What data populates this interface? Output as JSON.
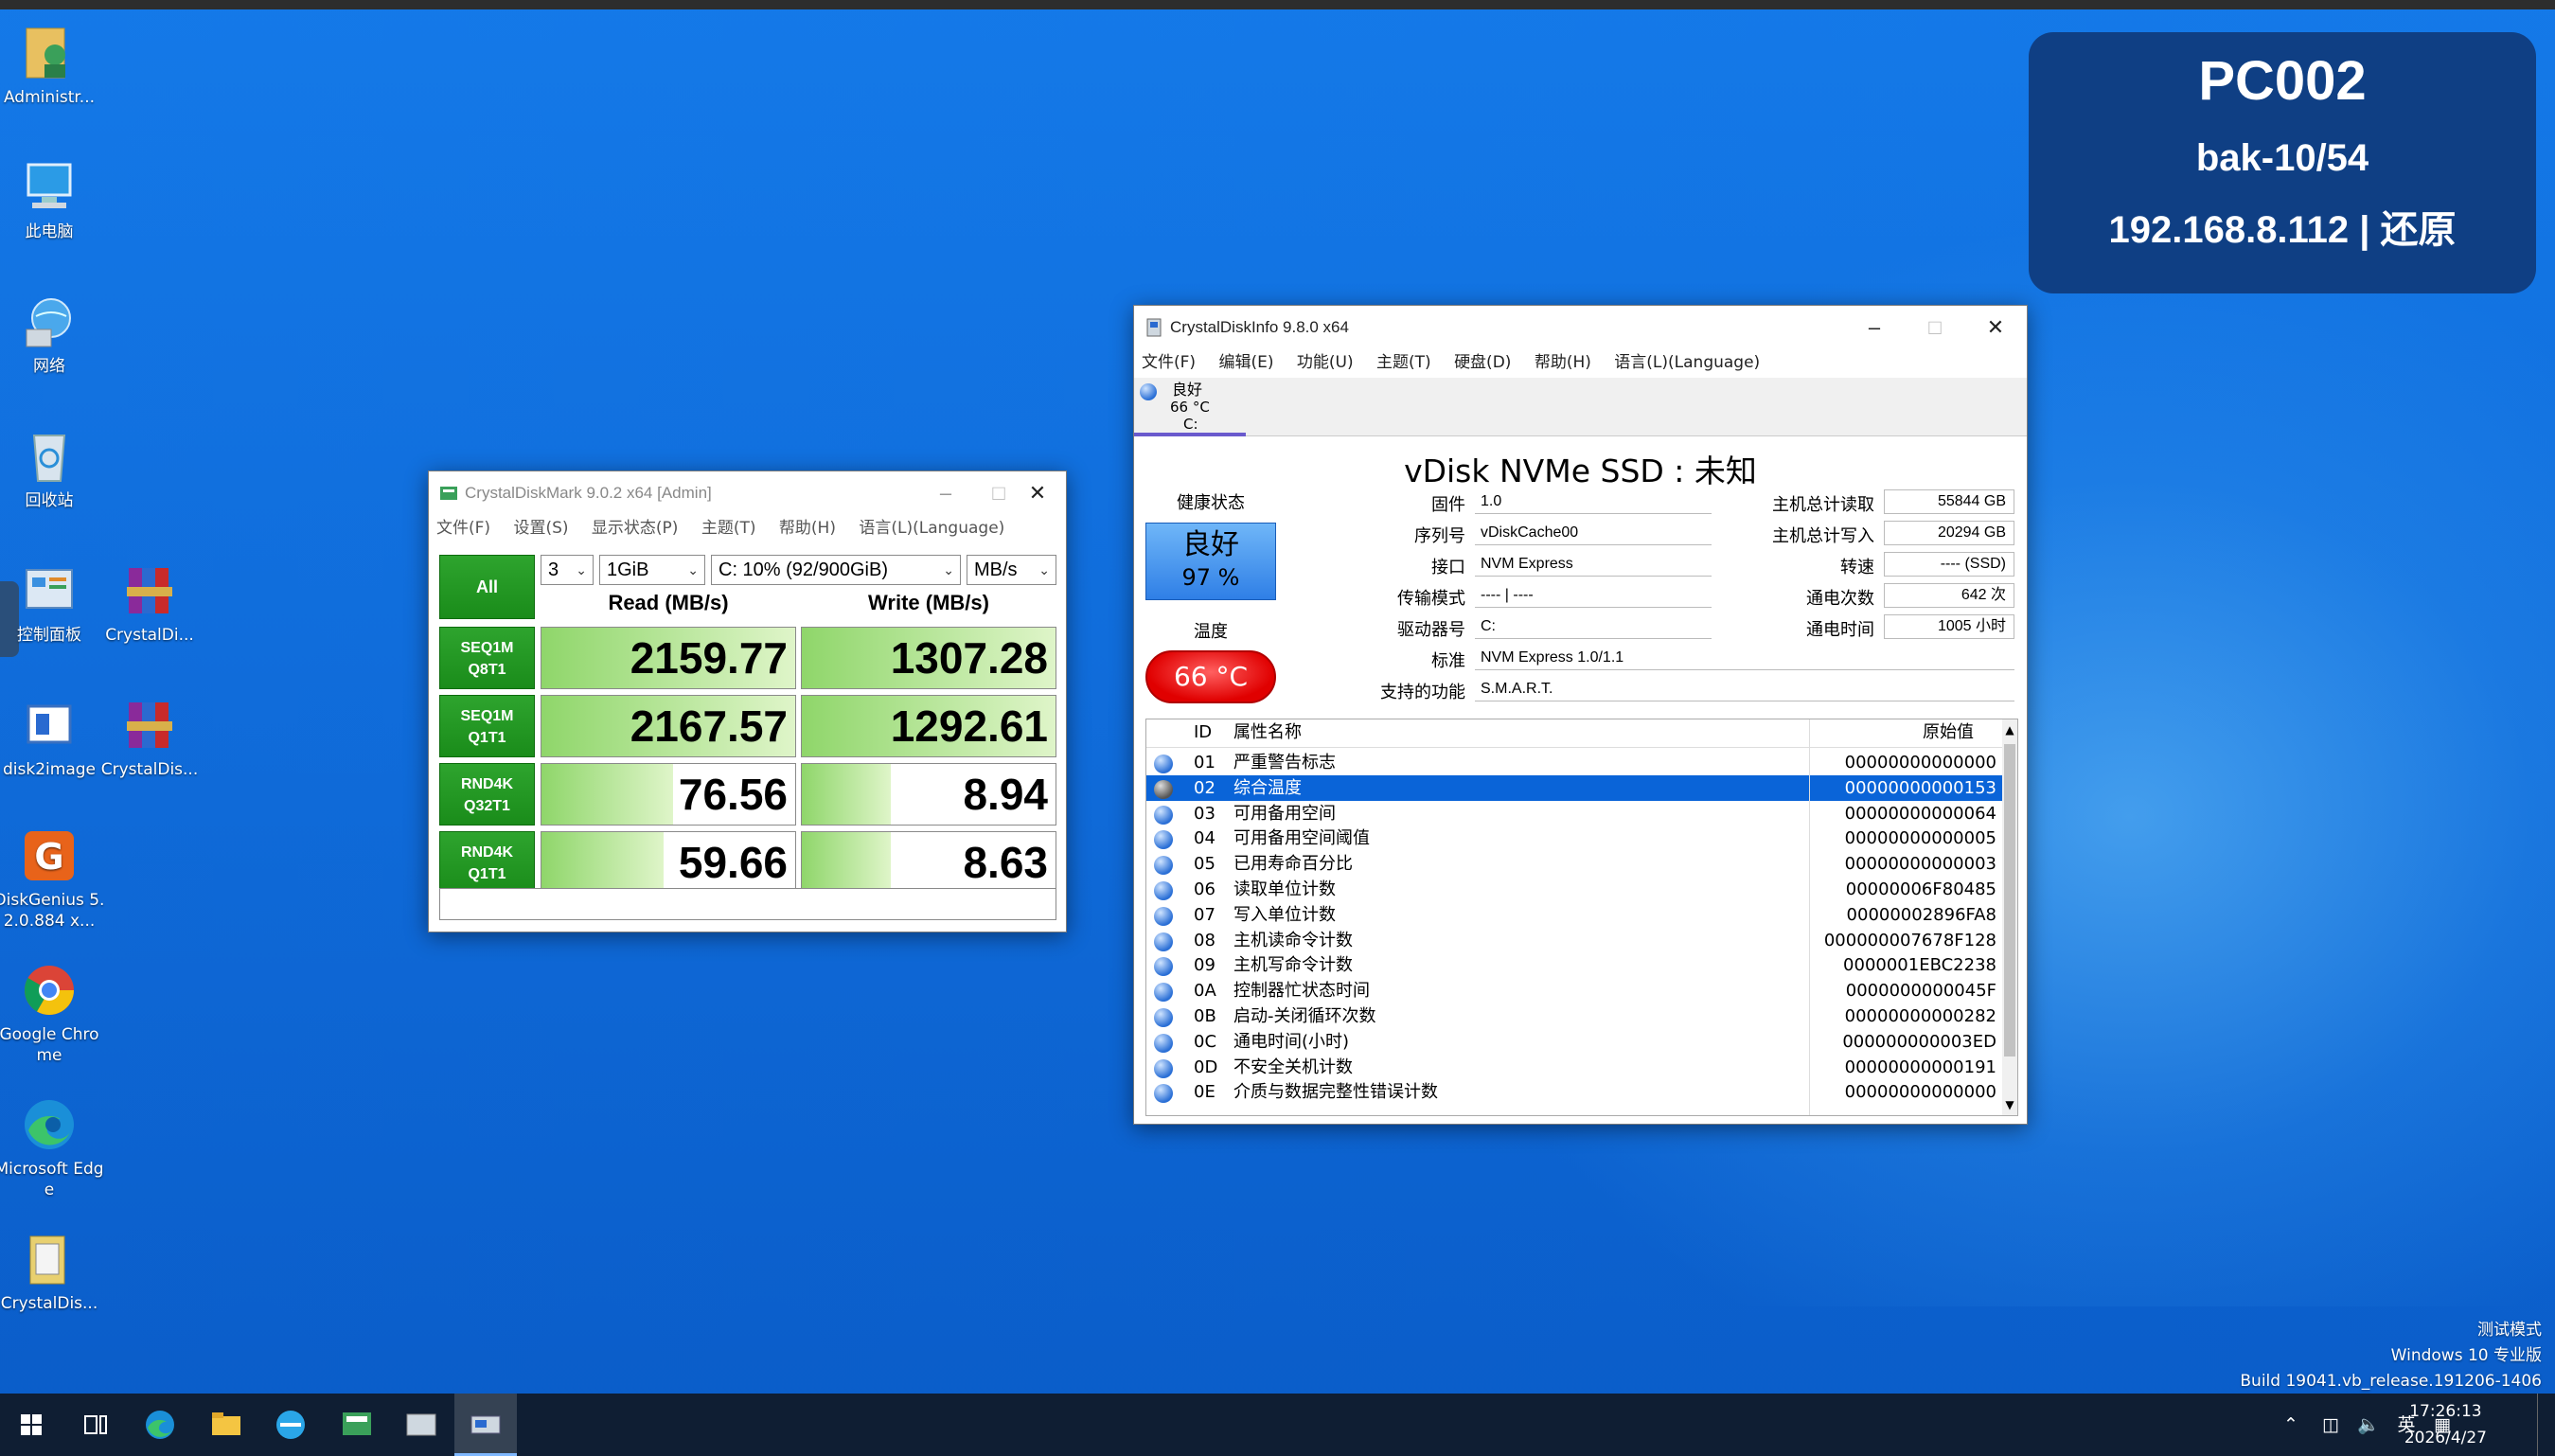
{
  "desktop": {
    "icons": [
      {
        "label": "Administr..."
      },
      {
        "label": "此电脑"
      },
      {
        "label": "网络"
      },
      {
        "label": "回收站"
      },
      {
        "label": "控制面板"
      },
      {
        "label": "CrystalDi..."
      },
      {
        "label": "disk2image"
      },
      {
        "label": "CrystalDis..."
      },
      {
        "label": "DiskGenius 5.2.0.884 x..."
      },
      {
        "label": "Google Chrome"
      },
      {
        "label": "Microsoft Edge"
      },
      {
        "label": "CrystalDis..."
      }
    ]
  },
  "info_panel": {
    "host": "PC002",
    "backup": "bak-10/54",
    "ip_mode": "192.168.8.112 | 还原"
  },
  "cdm": {
    "title": "CrystalDiskMark 9.0.2 x64 [Admin]",
    "menu": [
      "文件(F)",
      "设置(S)",
      "显示状态(P)",
      "主题(T)",
      "帮助(H)",
      "语言(L)(Language)"
    ],
    "all_label": "All",
    "count": "3",
    "size": "1GiB",
    "drive": "C: 10% (92/900GiB)",
    "unit": "MB/s",
    "read_header": "Read (MB/s)",
    "write_header": "Write (MB/s)",
    "rows": [
      {
        "l1": "SEQ1M",
        "l2": "Q8T1",
        "read": "2159.77",
        "write": "1307.28",
        "read_fill": 1.0,
        "write_fill": 1.0
      },
      {
        "l1": "SEQ1M",
        "l2": "Q1T1",
        "read": "2167.57",
        "write": "1292.61",
        "read_fill": 1.0,
        "write_fill": 1.0
      },
      {
        "l1": "RND4K",
        "l2": "Q32T1",
        "read": "76.56",
        "write": "8.94",
        "read_fill": 0.52,
        "write_fill": 0.35
      },
      {
        "l1": "RND4K",
        "l2": "Q1T1",
        "read": "59.66",
        "write": "8.63",
        "read_fill": 0.48,
        "write_fill": 0.35
      }
    ]
  },
  "cdi": {
    "title": "CrystalDiskInfo 9.8.0 x64",
    "menu": [
      "文件(F)",
      "编辑(E)",
      "功能(U)",
      "主题(T)",
      "硬盘(D)",
      "帮助(H)",
      "语言(L)(Language)"
    ],
    "tab": {
      "status": "良好",
      "temp": "66 °C",
      "drive": "C:"
    },
    "disk_title": "vDisk NVMe SSD : 未知",
    "health_label": "健康状态",
    "health_status": "良好",
    "health_pct": "97 %",
    "temp_label": "温度",
    "temp_value": "66 °C",
    "fields": [
      {
        "label": "固件",
        "value": "1.0"
      },
      {
        "label": "序列号",
        "value": "vDiskCache00"
      },
      {
        "label": "接口",
        "value": "NVM Express"
      },
      {
        "label": "传输模式",
        "value": "---- | ----"
      },
      {
        "label": "驱动器号",
        "value": "C:"
      },
      {
        "label": "标准",
        "value": "NVM Express 1.0/1.1"
      },
      {
        "label": "支持的功能",
        "value": "S.M.A.R.T."
      }
    ],
    "right_fields": [
      {
        "label": "主机总计读取",
        "value": "55844 GB"
      },
      {
        "label": "主机总计写入",
        "value": "20294 GB"
      },
      {
        "label": "转速",
        "value": "---- (SSD)"
      },
      {
        "label": "通电次数",
        "value": "642 次"
      },
      {
        "label": "通电时间",
        "value": "1005 小时"
      }
    ],
    "table_headers": {
      "id": "ID",
      "name": "属性名称",
      "raw": "原始值"
    },
    "attrs": [
      {
        "id": "01",
        "name": "严重警告标志",
        "raw": "00000000000000"
      },
      {
        "id": "02",
        "name": "综合温度",
        "raw": "00000000000153"
      },
      {
        "id": "03",
        "name": "可用备用空间",
        "raw": "00000000000064"
      },
      {
        "id": "04",
        "name": "可用备用空间阈值",
        "raw": "00000000000005"
      },
      {
        "id": "05",
        "name": "已用寿命百分比",
        "raw": "00000000000003"
      },
      {
        "id": "06",
        "name": "读取单位计数",
        "raw": "00000006F80485"
      },
      {
        "id": "07",
        "name": "写入单位计数",
        "raw": "00000002896FA8"
      },
      {
        "id": "08",
        "name": "主机读命令计数",
        "raw": "000000007678F128"
      },
      {
        "id": "09",
        "name": "主机写命令计数",
        "raw": "0000001EBC2238"
      },
      {
        "id": "0A",
        "name": "控制器忙状态时间",
        "raw": "0000000000045F"
      },
      {
        "id": "0B",
        "name": "启动-关闭循环次数",
        "raw": "00000000000282"
      },
      {
        "id": "0C",
        "name": "通电时间(小时)",
        "raw": "000000000003ED"
      },
      {
        "id": "0D",
        "name": "不安全关机计数",
        "raw": "00000000000191"
      },
      {
        "id": "0E",
        "name": "介质与数据完整性错误计数",
        "raw": "00000000000000"
      }
    ]
  },
  "watermark": {
    "line1": "测试模式",
    "line2": "Windows 10 专业版",
    "line3": "Build 19041.vb_release.191206-1406"
  },
  "tray": {
    "ime": "英",
    "time": "17:26:13",
    "date": "2026/4/27"
  }
}
